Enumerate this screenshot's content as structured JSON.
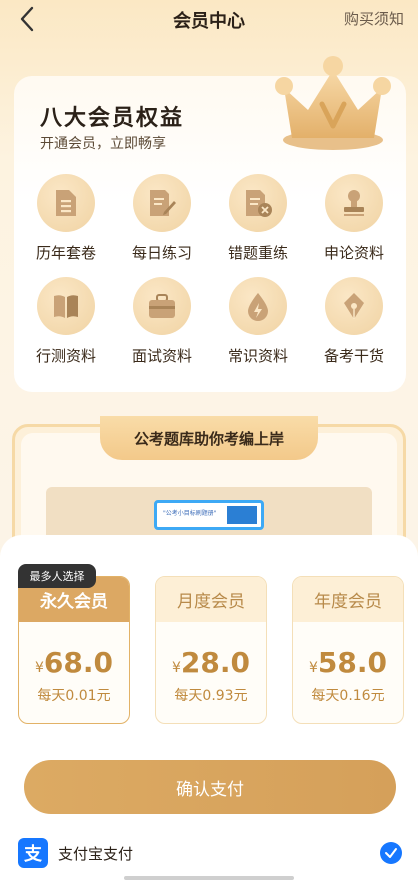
{
  "header": {
    "title": "会员中心",
    "notice_link": "购买须知"
  },
  "rights": {
    "title": "八大会员权益",
    "subtitle": "开通会员，立即畅享",
    "items": [
      {
        "label": "历年套卷",
        "icon": "document-icon"
      },
      {
        "label": "每日练习",
        "icon": "edit-note-icon"
      },
      {
        "label": "错题重练",
        "icon": "wrong-question-icon"
      },
      {
        "label": "申论资料",
        "icon": "stamp-icon"
      },
      {
        "label": "行测资料",
        "icon": "book-icon"
      },
      {
        "label": "面试资料",
        "icon": "briefcase-icon"
      },
      {
        "label": "常识资料",
        "icon": "lightning-drop-icon"
      },
      {
        "label": "备考干货",
        "icon": "pen-nib-icon"
      }
    ]
  },
  "promo": {
    "title": "公考题库助你考编上岸",
    "screen_text": "\"公考小目标刷题册\""
  },
  "plans": {
    "badge": "最多人选择",
    "items": [
      {
        "name": "永久会员",
        "currency": "¥",
        "price": "68.0",
        "per_day": "每天0.01元",
        "selected": true
      },
      {
        "name": "月度会员",
        "currency": "¥",
        "price": "28.0",
        "per_day": "每天0.93元",
        "selected": false
      },
      {
        "name": "年度会员",
        "currency": "¥",
        "price": "58.0",
        "per_day": "每天0.16元",
        "selected": false
      }
    ]
  },
  "confirm_label": "确认支付",
  "payment": {
    "icon_glyph": "支",
    "label": "支付宝支付",
    "checked": true
  },
  "colors": {
    "accent": "#dca863",
    "price": "#c08a3e",
    "alipay": "#1677ff"
  }
}
